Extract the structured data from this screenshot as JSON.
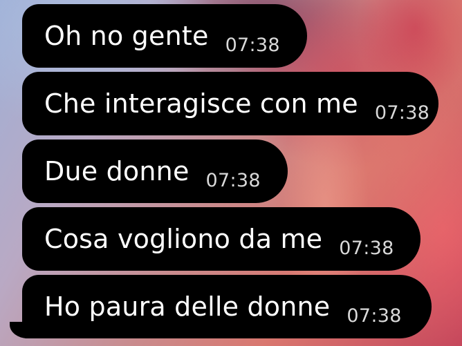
{
  "messages": [
    {
      "text": "Oh no gente",
      "time": "07:38"
    },
    {
      "text": "Che interagisce con me",
      "time": "07:38"
    },
    {
      "text": "Due donne",
      "time": "07:38"
    },
    {
      "text": "Cosa vogliono da me",
      "time": "07:38"
    },
    {
      "text": "Ho paura delle donne",
      "time": "07:38"
    }
  ],
  "colors": {
    "bubble": "#000000",
    "text": "#ffffff",
    "time": "#d9d9d9"
  }
}
